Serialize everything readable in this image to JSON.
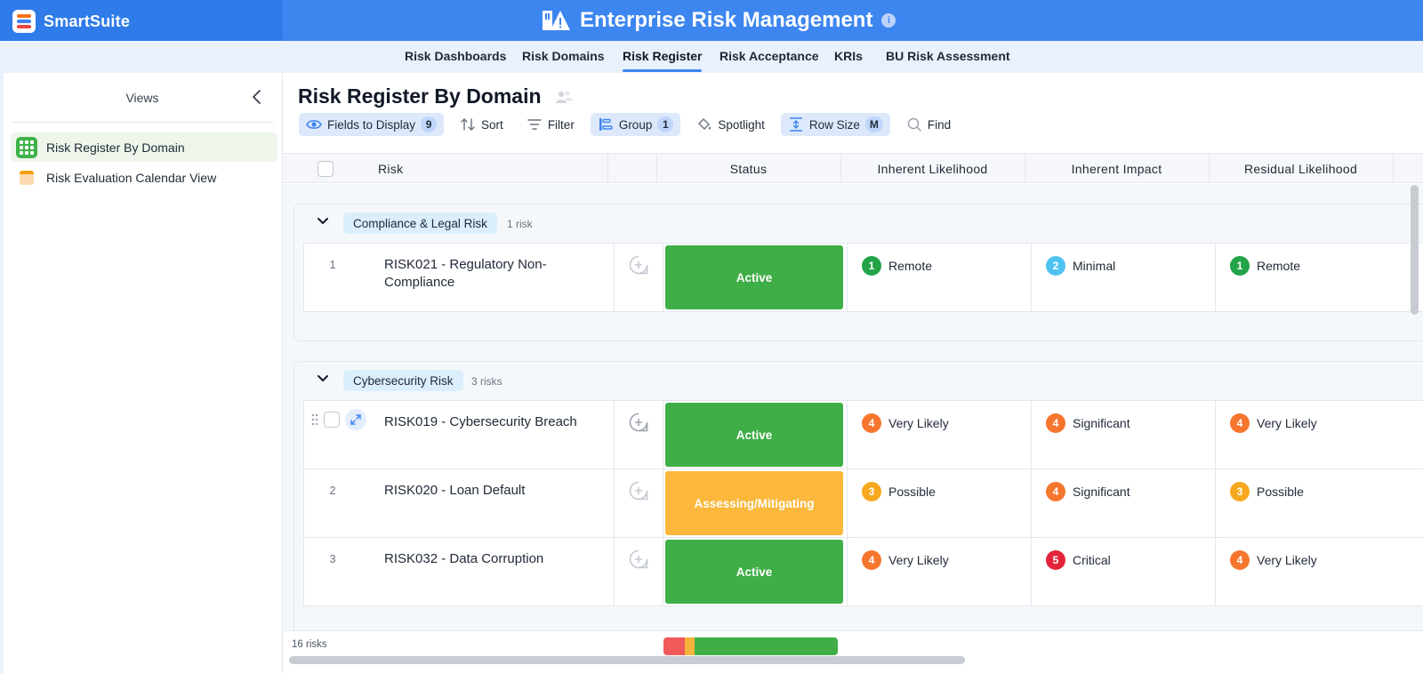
{
  "brand": {
    "name": "SmartSuite"
  },
  "app": {
    "title": "Enterprise Risk Management"
  },
  "nav": {
    "tabs": [
      {
        "label": "Risk Dashboards"
      },
      {
        "label": "Risk Domains"
      },
      {
        "label": "Risk Register",
        "active": true
      },
      {
        "label": "Risk Acceptance"
      },
      {
        "label": "KRIs"
      },
      {
        "label": "BU Risk Assessment"
      }
    ]
  },
  "sidebar": {
    "title": "Views",
    "items": [
      {
        "label": "Risk Register By Domain",
        "active": true
      },
      {
        "label": "Risk Evaluation Calendar View"
      }
    ]
  },
  "main": {
    "title": "Risk Register By Domain",
    "toolbar": {
      "fields": {
        "label": "Fields to Display",
        "count": "9"
      },
      "sort": {
        "label": "Sort"
      },
      "filter": {
        "label": "Filter"
      },
      "group": {
        "label": "Group",
        "count": "1"
      },
      "spotlight": {
        "label": "Spotlight"
      },
      "rowsize": {
        "label": "Row Size",
        "value": "M"
      },
      "find": {
        "label": "Find"
      }
    },
    "columns": {
      "risk": "Risk",
      "status": "Status",
      "inherent_likelihood": "Inherent Likelihood",
      "inherent_impact": "Inherent Impact",
      "residual_likelihood": "Residual Likelihood"
    },
    "groups": [
      {
        "name": "Compliance & Legal Risk",
        "count": "1 risk",
        "rows": [
          {
            "num": "1",
            "risk": "RISK021 - Regulatory Non-Compliance",
            "status": "Active",
            "inherent_likelihood": {
              "score": "1",
              "label": "Remote"
            },
            "inherent_impact": {
              "score": "2",
              "label": "Minimal"
            },
            "residual_likelihood": {
              "score": "1",
              "label": "Remote"
            }
          }
        ]
      },
      {
        "name": "Cybersecurity Risk",
        "count": "3 risks",
        "rows": [
          {
            "num": "",
            "risk": "RISK019 - Cybersecurity Breach",
            "status": "Active",
            "inherent_likelihood": {
              "score": "4",
              "label": "Very Likely"
            },
            "inherent_impact": {
              "score": "4",
              "label": "Significant"
            },
            "residual_likelihood": {
              "score": "4",
              "label": "Very Likely"
            }
          },
          {
            "num": "2",
            "risk": "RISK020 - Loan Default",
            "status": "Assessing/Mitigating",
            "inherent_likelihood": {
              "score": "3",
              "label": "Possible"
            },
            "inherent_impact": {
              "score": "4",
              "label": "Significant"
            },
            "residual_likelihood": {
              "score": "3",
              "label": "Possible"
            }
          },
          {
            "num": "3",
            "risk": "RISK032 - Data Corruption",
            "status": "Active",
            "inherent_likelihood": {
              "score": "4",
              "label": "Very Likely"
            },
            "inherent_impact": {
              "score": "5",
              "label": "Critical"
            },
            "residual_likelihood": {
              "score": "4",
              "label": "Very Likely"
            }
          }
        ]
      }
    ],
    "footer": {
      "count": "16 risks",
      "status_summary": [
        {
          "color": "#f05a5a",
          "share": 0.12
        },
        {
          "color": "#f6b33a",
          "share": 0.06
        },
        {
          "color": "#3fae47",
          "share": 0.82
        }
      ]
    }
  },
  "colors": {
    "header": "#3d86f0",
    "active": "#3fae47",
    "assessing": "#fbb83c",
    "score_1": "#22a447",
    "score_2": "#4fc3f0",
    "score_3": "#f7a81e",
    "score_4": "#f6762e",
    "score_5": "#e3243b"
  }
}
